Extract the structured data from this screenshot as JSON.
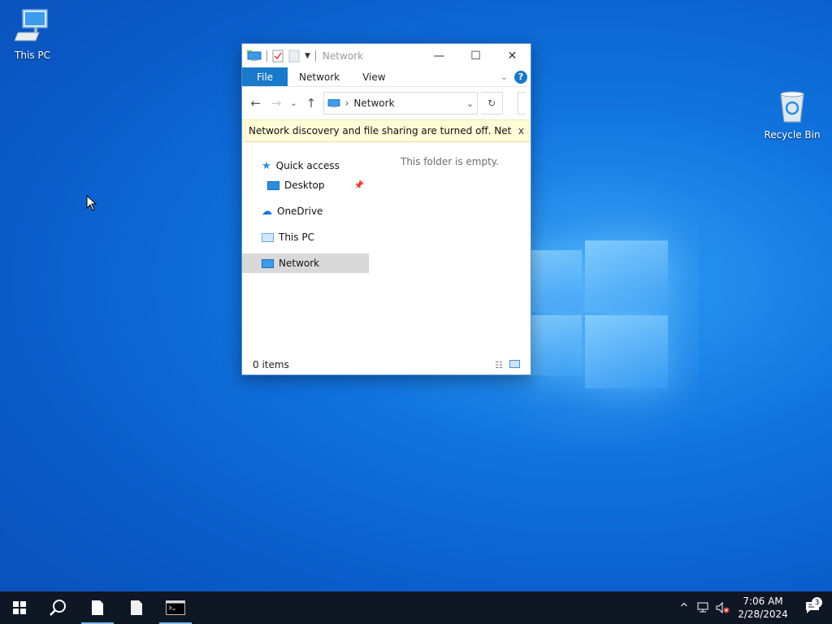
{
  "desktop": {
    "icons": [
      {
        "label": "This PC"
      },
      {
        "label": "Recycle Bin"
      }
    ]
  },
  "explorer": {
    "title": "Network",
    "ribbon": {
      "file_tab": "File",
      "tabs": [
        "Network",
        "View"
      ],
      "help": "?"
    },
    "address": {
      "path": "Network"
    },
    "infobar": {
      "message": "Network discovery and file sharing are turned off. Network computers and devices are not visible. Click to change...",
      "close": "x"
    },
    "nav": {
      "quick_access": "Quick access",
      "desktop": "Desktop",
      "onedrive": "OneDrive",
      "this_pc": "This PC",
      "network": "Network"
    },
    "empty_message": "This folder is empty.",
    "status": "0 items"
  },
  "taskbar": {
    "clock_time": "7:06 AM",
    "clock_date": "2/28/2024",
    "notification_count": "3"
  },
  "colors": {
    "accent": "#1979ca",
    "taskbar": "#0f1725",
    "infobar": "#fffbd6",
    "selected": "#d9d9d9"
  }
}
